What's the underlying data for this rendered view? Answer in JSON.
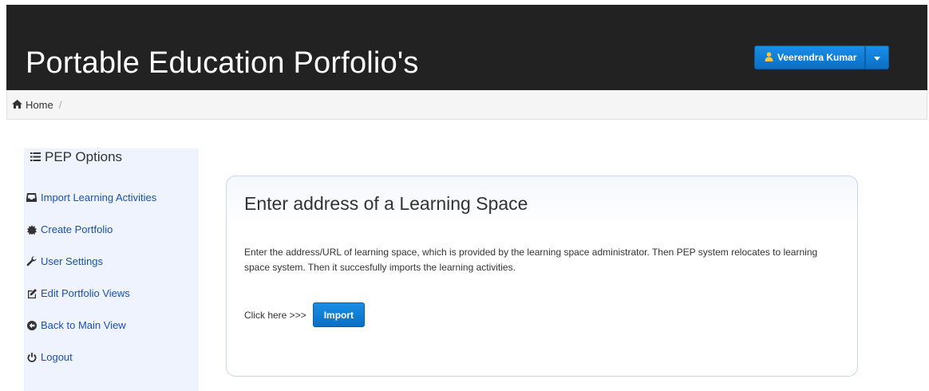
{
  "header": {
    "title": "Portable Education Porfolio's",
    "user_label": "Veerendra Kumar",
    "user_icon": "user-icon",
    "caret_icon": "caret-down-icon"
  },
  "breadcrumb": {
    "home_label": "Home",
    "separator": "/"
  },
  "sidebar": {
    "heading": "PEP Options",
    "items": [
      {
        "label": "Import Learning Activities",
        "icon": "inbox-icon"
      },
      {
        "label": "Create Portfolio",
        "icon": "certificate-icon"
      },
      {
        "label": "User Settings",
        "icon": "wrench-icon"
      },
      {
        "label": "Edit Portfolio Views",
        "icon": "edit-icon"
      },
      {
        "label": "Back to Main View",
        "icon": "arrow-circle-left-icon"
      },
      {
        "label": "Logout",
        "icon": "power-icon"
      }
    ]
  },
  "panel": {
    "title": "Enter address of a Learning Space",
    "description": "Enter the address/URL of learning space, which is provided by the learning space administrator. Then PEP system relocates to learning space system. Then it succesfully imports the learning activities.",
    "click_label": "Click here >>>",
    "import_label": "Import"
  },
  "colors": {
    "header_bg": "#222222",
    "accent": "#0a6fc4",
    "link": "#1a4fb5",
    "sidebar_bg": "#eef3fd"
  }
}
